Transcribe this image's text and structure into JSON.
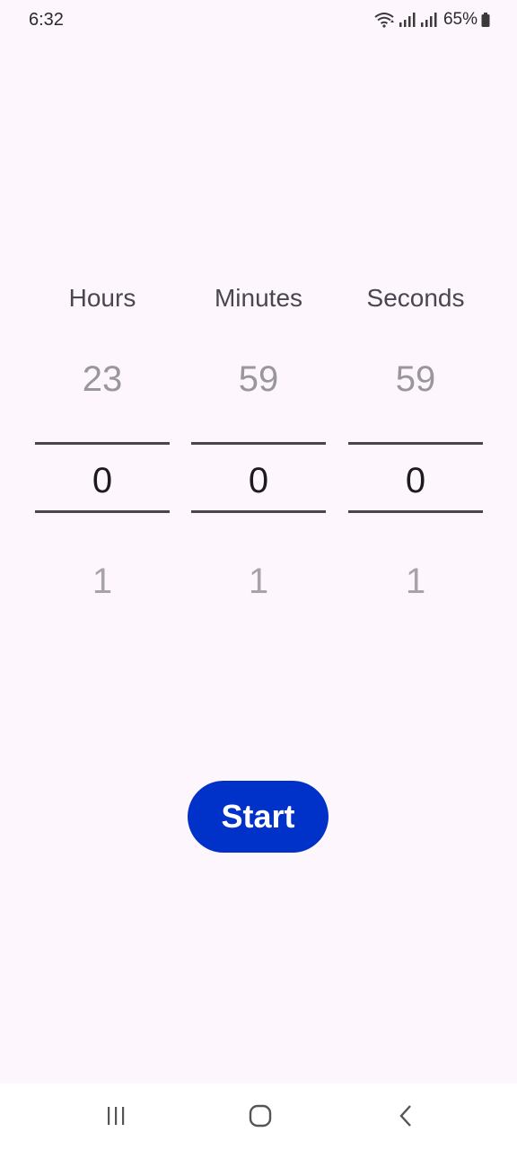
{
  "status_bar": {
    "time": "6:32",
    "battery": "65%"
  },
  "picker": {
    "hours": {
      "label": "Hours",
      "prev": "23",
      "current": "0",
      "next": "1"
    },
    "minutes": {
      "label": "Minutes",
      "prev": "59",
      "current": "0",
      "next": "1"
    },
    "seconds": {
      "label": "Seconds",
      "prev": "59",
      "current": "0",
      "next": "1"
    }
  },
  "start_button": {
    "label": "Start",
    "color": "#0031c8"
  },
  "nav_bar": {
    "icons": [
      "recents-icon",
      "home-icon",
      "back-icon"
    ]
  }
}
